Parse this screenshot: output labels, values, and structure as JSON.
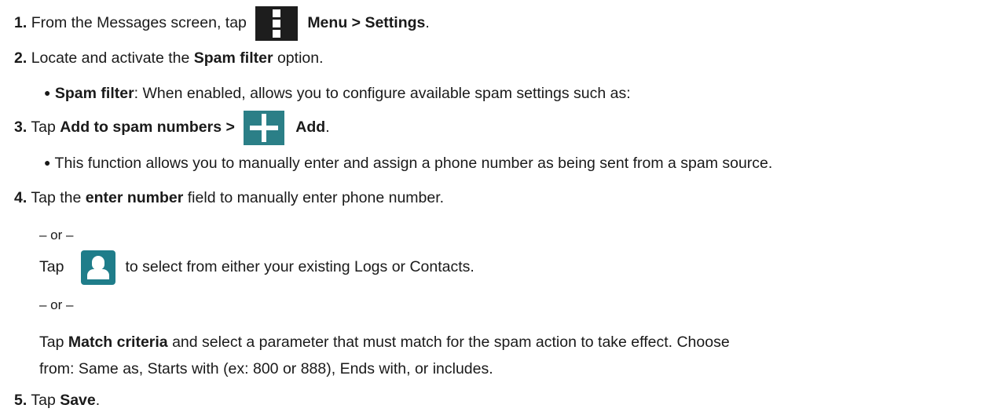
{
  "steps": [
    {
      "num": "1.",
      "before": "From the Messages screen, tap",
      "bold": "Menu > Settings",
      "after": "."
    },
    {
      "num": "2.",
      "before": "Locate and activate the ",
      "bold": "Spam filter",
      "after": " option."
    },
    {
      "bullet": "●",
      "bold": "Spam filter",
      "after": ": When enabled, allows you to configure available spam settings such as:"
    },
    {
      "num": "3.",
      "before": "Tap ",
      "bold": "Add to spam numbers >",
      "bold2": "Add",
      "after": "."
    },
    {
      "bullet": "●",
      "text": "This function allows you to manually enter and assign a phone number as being sent from a spam source."
    },
    {
      "num": "4.",
      "before": "Tap the ",
      "bold": "enter number",
      "after": " field to manually enter phone number."
    },
    {
      "or": "– or –"
    },
    {
      "before": "Tap",
      "after": "to select from either your existing Logs or Contacts."
    },
    {
      "or": "– or –"
    },
    {
      "before": "Tap ",
      "bold": "Match criteria",
      "after": " and select a parameter that must match for the spam action to take effect. Choose"
    },
    {
      "text": "from: Same as, Starts with (ex: 800 or 888), Ends with, or includes."
    },
    {
      "num": "5.",
      "before": "Tap ",
      "bold": "Save",
      "after": "."
    }
  ],
  "icons": {
    "menu": "menu-icon",
    "add": "add-icon",
    "contact": "contact-icon",
    "menu_color": "#1d1d1d",
    "add_color": "#2b7f87",
    "contact_color": "#1f7d8a"
  }
}
